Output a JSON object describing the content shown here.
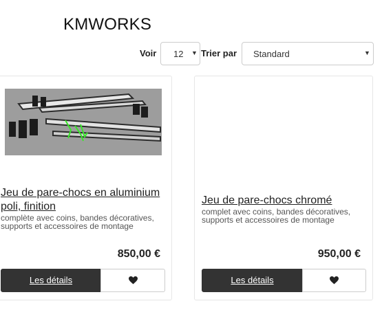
{
  "header": {
    "brand": "KMWORKS"
  },
  "toolbar": {
    "show_label": "Voir",
    "show_value": "12",
    "sort_label": "Trier par",
    "sort_value": "Standard"
  },
  "products": [
    {
      "title": "Jeu de pare-chocs en aluminium poli, finition",
      "description": "complète avec coins, bandes décoratives, supports et accessoires de montage",
      "price": "850,00 €",
      "details_label": "Les détails",
      "wishlist_icon": "heart-icon"
    },
    {
      "title": "Jeu de pare-chocs chromé",
      "description": "complet avec coins, bandes décoratives, supports et accessoires de montage",
      "price": "950,00 €",
      "details_label": "Les détails",
      "wishlist_icon": "heart-icon"
    }
  ],
  "colors": {
    "button_dark": "#333333",
    "border": "#e6e6e6"
  }
}
